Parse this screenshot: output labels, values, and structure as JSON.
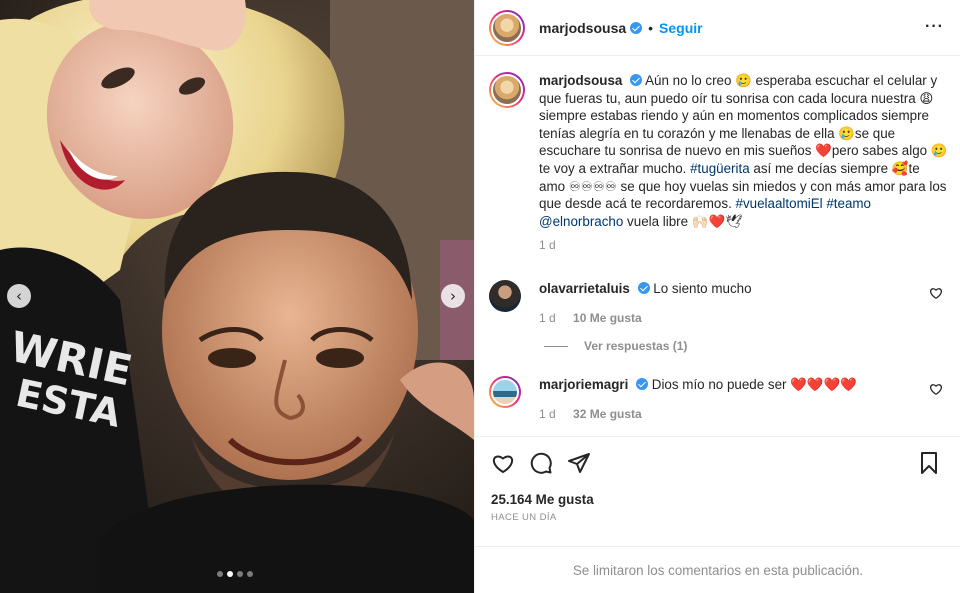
{
  "post": {
    "username": "marjodsousa",
    "separator": "•",
    "follow_label": "Seguir",
    "more_label": "···"
  },
  "caption": {
    "username": "marjodsousa",
    "text_part1": "Aún no lo creo 🥲 esperaba escuchar el celular y que fueras tu, aun puedo oír tu sonrisa con cada locura nuestra 😩 siempre estabas riendo y aún en momentos complicados siempre tenías alegría en tu corazón y me llenabas de ella 🥲se que escuchare tu sonrisa de nuevo en mis sueños ❤️pero sabes algo 🥲te voy a extrañar mucho. ",
    "tag1": "#tugüerita",
    "text_part2": " así me decías siempre 🥰te amo ♾♾♾♾ se que hoy vuelas sin miedos y con más amor para los que desde acá te recordaremos. ",
    "tag2": "#vuelaaltomiEl",
    "tag3": "#teamo",
    "mention": "@elnorbracho",
    "text_part3": " vuela libre 🙌🏻❤️🕊",
    "time": "1 d"
  },
  "comments": [
    {
      "username": "olavarrietaluis",
      "text": "Lo siento mucho",
      "time": "1 d",
      "likes": "10 Me gusta"
    },
    {
      "username": "marjoriemagri",
      "text": "Dios mío no puede ser ❤️❤️❤️❤️",
      "time": "1 d",
      "likes": "32 Me gusta"
    }
  ],
  "replies_label": "Ver respuestas (1)",
  "likes_count": "25.164 Me gusta",
  "time_ago": "HACE UN DÍA",
  "footer_text": "Se limitaron los comentarios en esta publicación.",
  "nav": {
    "prev": "‹",
    "next": "›"
  },
  "carousel": {
    "total": 4,
    "active": 2
  },
  "colors": {
    "link": "#00376b",
    "follow": "#0095f6",
    "verified": "#3897f0",
    "muted": "#8e8e8e"
  }
}
